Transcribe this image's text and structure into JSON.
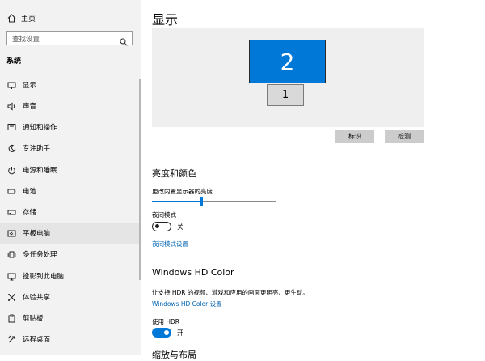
{
  "sidebar": {
    "home_label": "主页",
    "search_placeholder": "查找设置",
    "section_title": "系统",
    "items": [
      {
        "label": "显示",
        "icon": "monitor-icon"
      },
      {
        "label": "声音",
        "icon": "speaker-icon"
      },
      {
        "label": "通知和操作",
        "icon": "notification-icon"
      },
      {
        "label": "专注助手",
        "icon": "moon-icon"
      },
      {
        "label": "电源和睡眠",
        "icon": "power-icon"
      },
      {
        "label": "电池",
        "icon": "battery-icon"
      },
      {
        "label": "存储",
        "icon": "storage-icon"
      },
      {
        "label": "平板电脑",
        "icon": "tablet-icon"
      },
      {
        "label": "多任务处理",
        "icon": "multitask-icon"
      },
      {
        "label": "投影到此电脑",
        "icon": "project-icon"
      },
      {
        "label": "体验共享",
        "icon": "share-icon"
      },
      {
        "label": "剪贴板",
        "icon": "clipboard-icon"
      },
      {
        "label": "远程桌面",
        "icon": "remote-desktop-icon"
      }
    ],
    "selected_index": 7
  },
  "main": {
    "title": "显示",
    "monitors": {
      "primary_number": "2",
      "secondary_number": "1"
    },
    "identify_label": "标识",
    "detect_label": "检测",
    "brightness_section": "亮度和颜色",
    "brightness_label": "更改内置显示器的亮度",
    "brightness_level": 0.4,
    "night_mode_label": "夜间模式",
    "night_mode_state": "关",
    "night_mode_link": "夜间模式设置",
    "hdr_section": "Windows HD Color",
    "hdr_description": "让支持 HDR 的视频、游戏和应用的画面更明亮、更生动。",
    "hdr_link": "Windows HD Color 设置",
    "use_hdr_label": "使用 HDR",
    "use_hdr_state": "开",
    "next_section": "缩放与布局"
  },
  "colors": {
    "accent": "#0078d7",
    "link": "#0063b1"
  }
}
